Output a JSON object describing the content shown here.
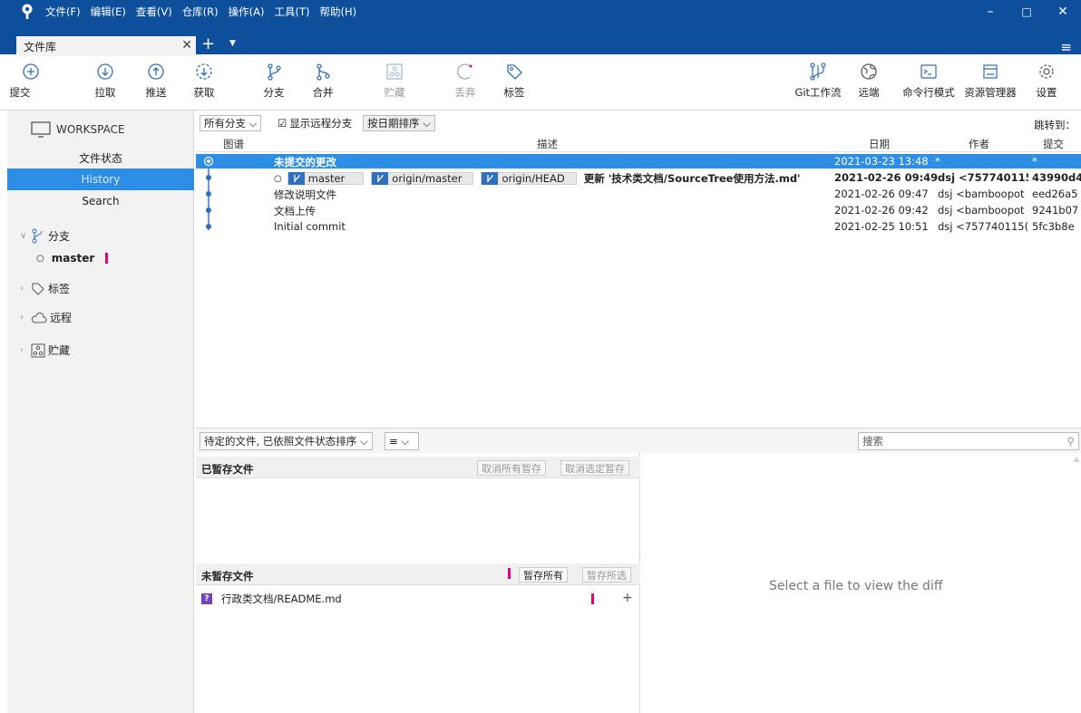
{
  "menu": [
    "文件(F)",
    "编辑(E)",
    "查看(V)",
    "仓库(R)",
    "操作(A)",
    "工具(T)",
    "帮助(H)"
  ],
  "window": {
    "minimize": "–",
    "maximize": "□",
    "close": "✕"
  },
  "tab": {
    "title": "文件库",
    "close": "✕",
    "add": "+",
    "dropdown": "▼",
    "menu": "≡"
  },
  "toolbar": {
    "commit": "提交",
    "pull": "拉取",
    "push": "推送",
    "fetch": "获取",
    "branch": "分支",
    "merge": "合并",
    "stash": "贮藏",
    "discard": "丢弃",
    "tag": "标签",
    "gitflow": "Git工作流",
    "remote": "远端",
    "terminal": "命令行模式",
    "explorer": "资源管理器",
    "settings": "设置"
  },
  "sidebar": {
    "workspace": "WORKSPACE",
    "items": [
      "文件状态",
      "History",
      "Search"
    ],
    "branches_label": "分支",
    "current_branch": "master",
    "tags_label": "标签",
    "remotes_label": "远程",
    "stashes_label": "贮藏"
  },
  "filter": {
    "all_branches": "所有分支 ⌵",
    "show_remote": "显示远程分支",
    "sort": "按日期排序 ⌵",
    "jump_to": "跳转到："
  },
  "history": {
    "columns": {
      "graph": "图谱",
      "desc": "描述",
      "date": "日期",
      "author": "作者",
      "commit": "提交"
    },
    "rows": [
      {
        "desc": "未提交的更改",
        "date": "2021-03-23 13:48",
        "date_suffix": "*",
        "author": "",
        "commit": "*"
      },
      {
        "refs": [
          "master",
          "origin/master",
          "origin/HEAD"
        ],
        "desc": "更新 '技术类文档/SourceTree使用方法.md'",
        "date": "2021-02-26 09:49",
        "author": "dsj <757740115(",
        "commit": "43990d4"
      },
      {
        "desc": "修改说明文件",
        "date": "2021-02-26 09:47",
        "author": "dsj <bamboopot",
        "commit": "eed26a5"
      },
      {
        "desc": "文档上传",
        "date": "2021-02-26 09:42",
        "author": "dsj <bamboopot",
        "commit": "9241b07"
      },
      {
        "desc": "Initial commit",
        "date": "2021-02-25 10:51",
        "author": "dsj <757740115(",
        "commit": "5fc3b8e"
      }
    ]
  },
  "bottom": {
    "pending_sort": "待定的文件, 已依照文件状态排序 ⌵",
    "view_mode": "≡ ⌵",
    "search_placeholder": "搜索",
    "staged": {
      "title": "已暂存文件",
      "unstage_all": "取消所有暂存",
      "unstage_selected": "取消选定暂存"
    },
    "unstaged": {
      "title": "未暂存文件",
      "stage_all": "暂存所有",
      "stage_selected": "暂存所选"
    },
    "files": [
      {
        "status": "?",
        "path": "行政类文档/README.md",
        "action": "+"
      }
    ],
    "diff_placeholder": "Select a file to view the diff"
  },
  "colors": {
    "titlebar": "#0e4f9c",
    "selection": "#2e8ee6",
    "ref_icon": "#2e6fbf",
    "marker": "#e6007a",
    "untracked": "#7a3fc4"
  }
}
